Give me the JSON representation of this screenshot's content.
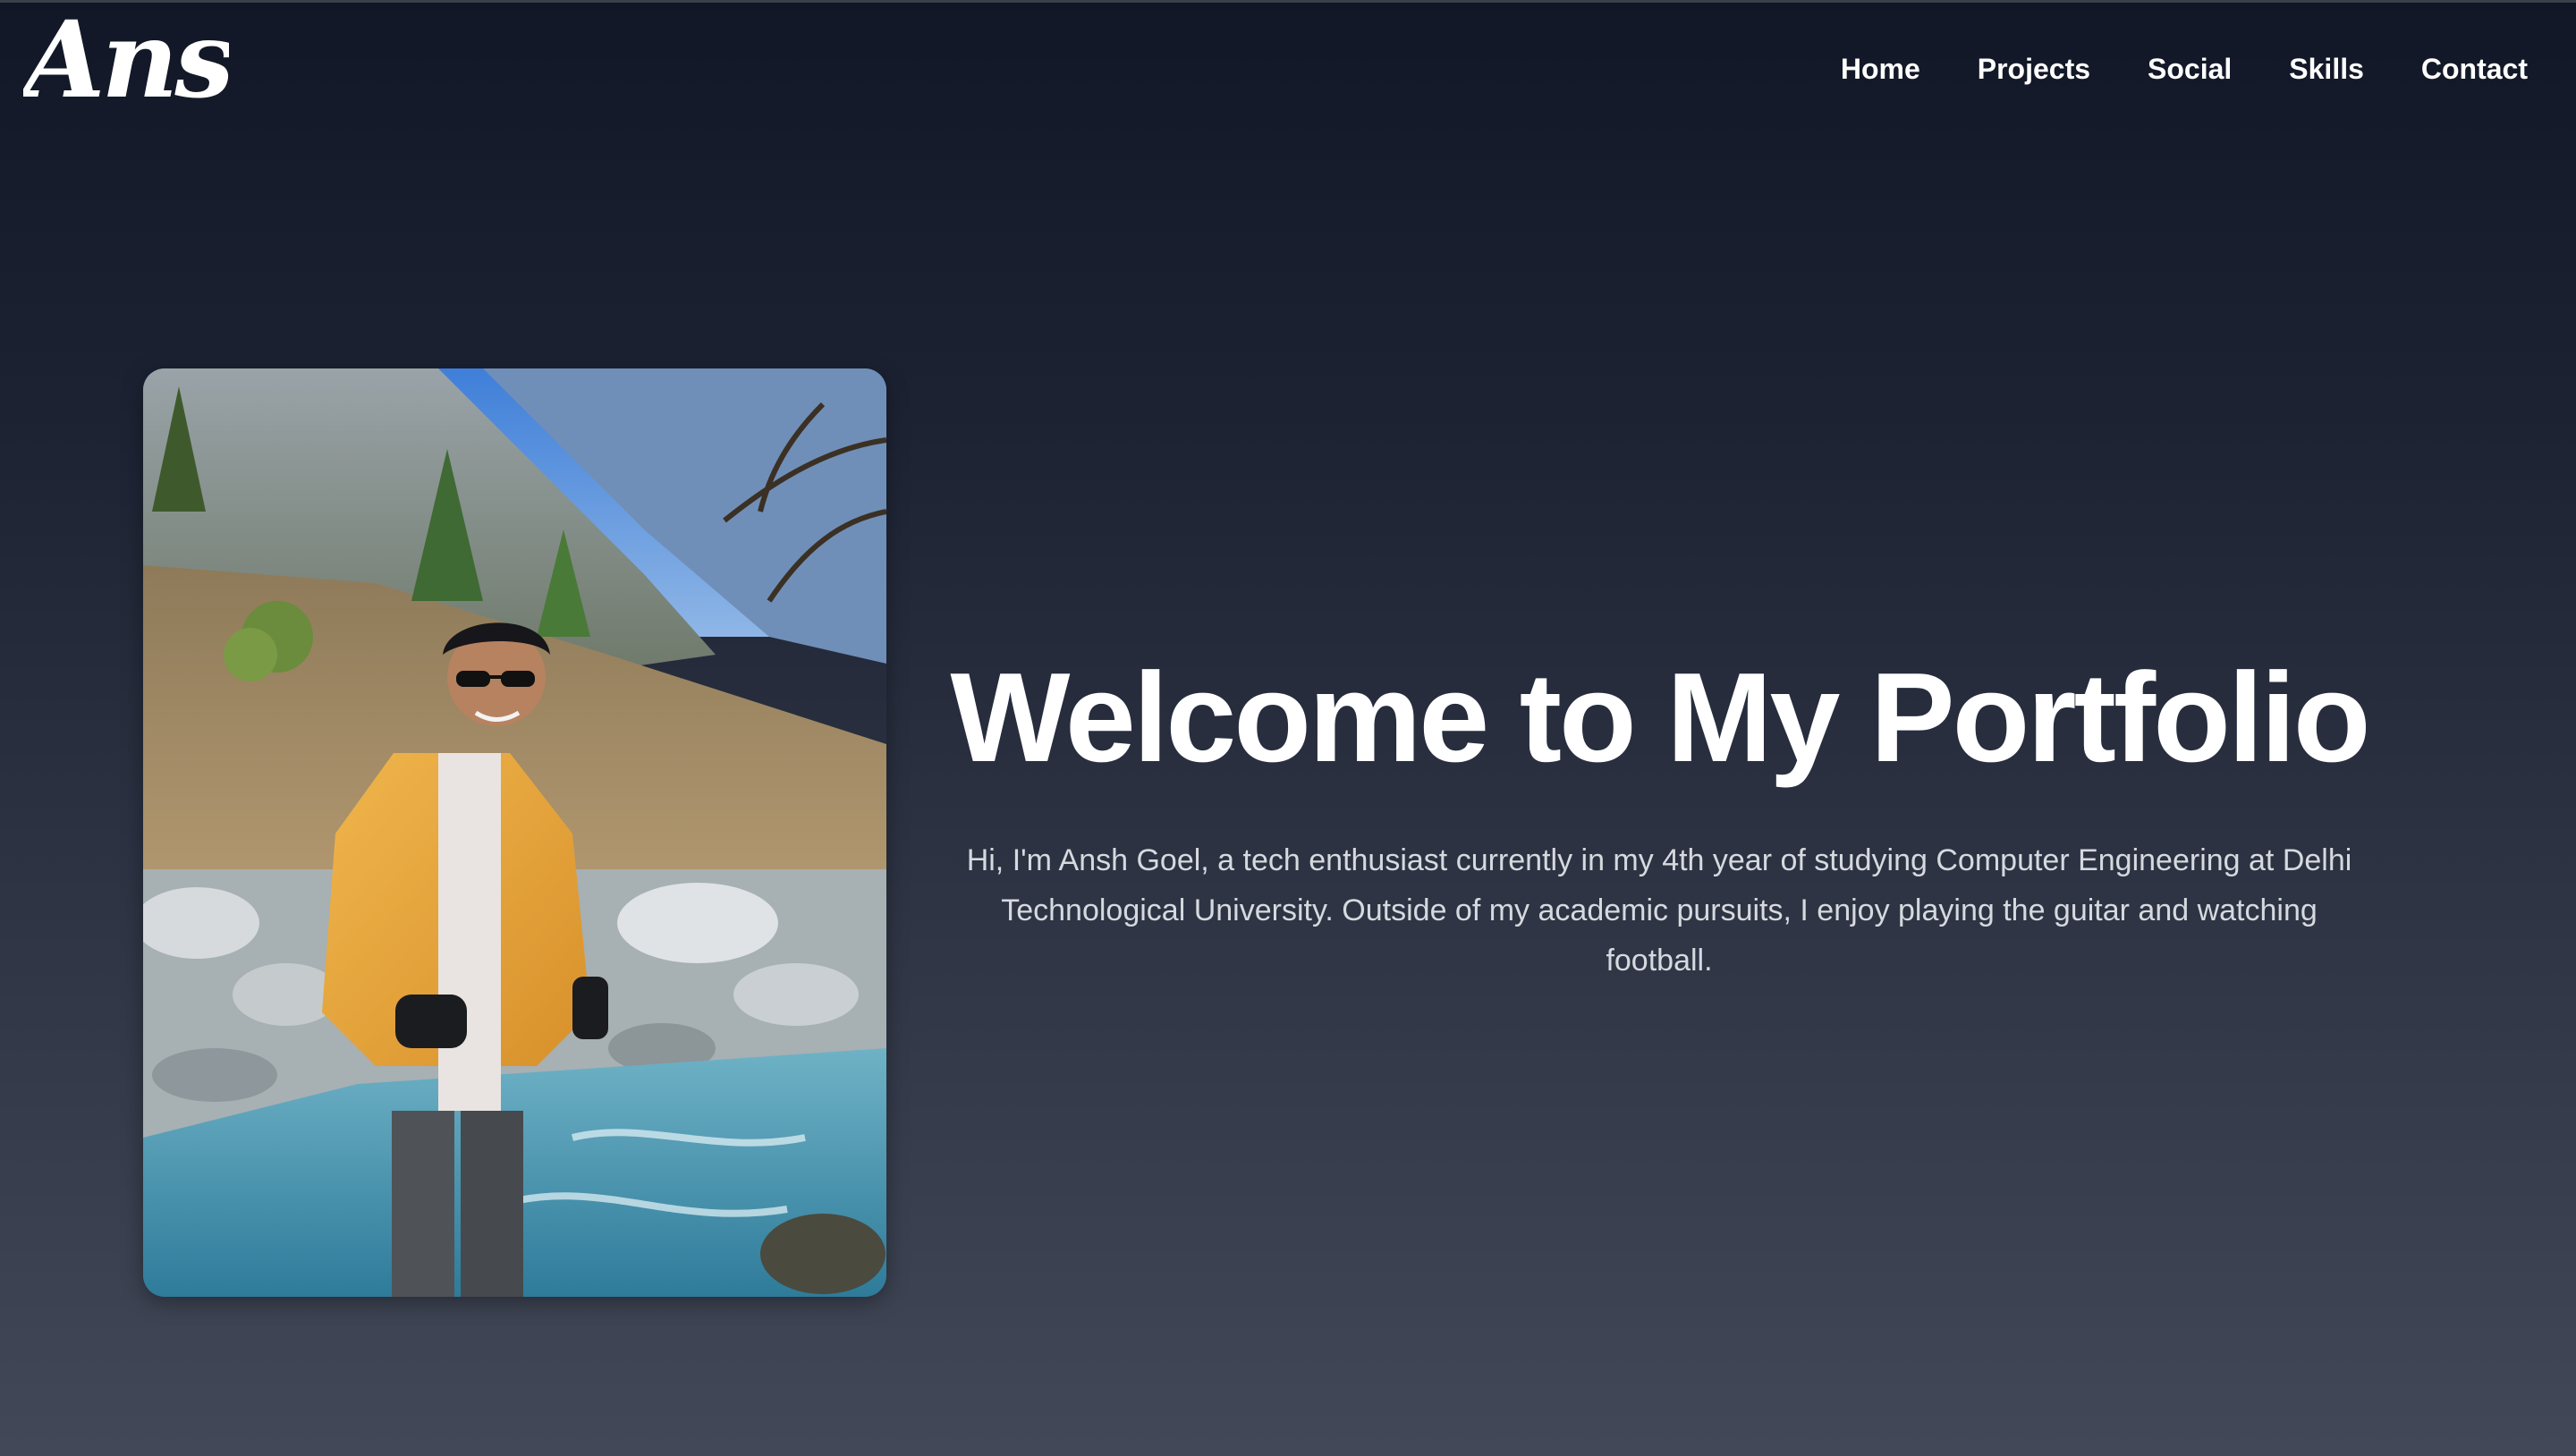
{
  "logo": {
    "text": "Ansh"
  },
  "nav": {
    "items": [
      {
        "label": "Home"
      },
      {
        "label": "Projects"
      },
      {
        "label": "Social"
      },
      {
        "label": "Skills"
      },
      {
        "label": "Contact"
      }
    ]
  },
  "hero": {
    "title": "Welcome to My Portfolio",
    "bio": "Hi, I'm Ansh Goel, a tech enthusiast currently in my 4th year of studying Computer Engineering at Delhi Technological University. Outside of my academic pursuits, I enjoy playing the guitar and watching football.",
    "photo": {
      "subject": "profile-photo"
    }
  },
  "colors": {
    "background_top": "#111726",
    "background_bottom": "#424857",
    "text": "#ffffff",
    "body_text": "#d6d9de"
  }
}
